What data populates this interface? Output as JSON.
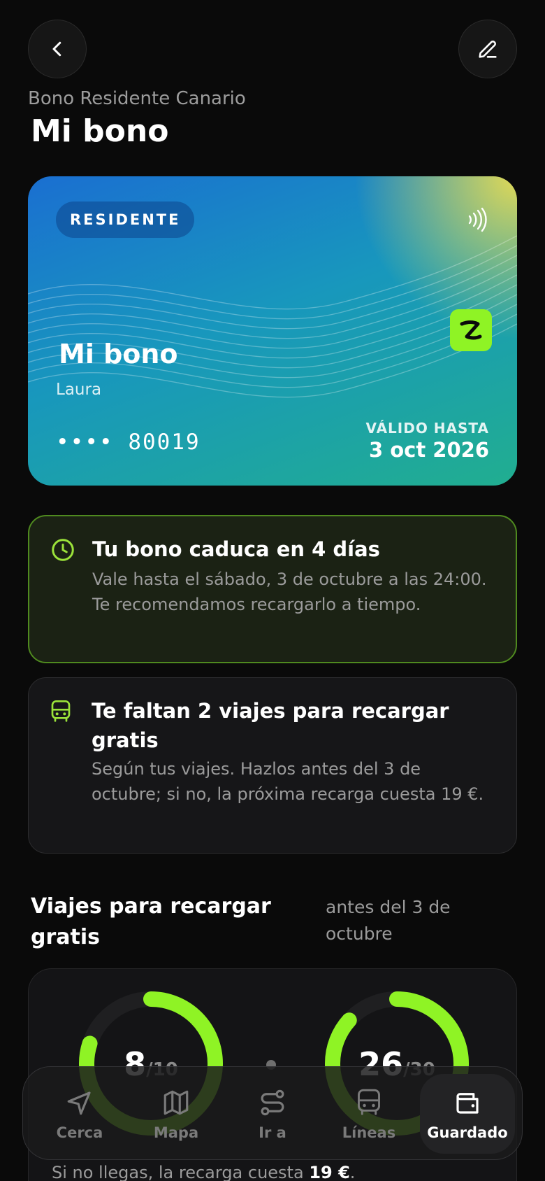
{
  "header": {
    "subtitle": "Bono Residente Canario",
    "title": "Mi bono",
    "back_icon": "chevron-left-icon",
    "edit_icon": "pencil-icon"
  },
  "card": {
    "badge": "RESIDENTE",
    "name": "Mi bono",
    "owner": "Laura",
    "number": "•••• 80019",
    "valid_label": "VÁLIDO HASTA",
    "valid_date": "3 oct 2026",
    "logo_icon": "guaguas-logo-icon",
    "nfc_icon": "contactless-icon",
    "colors": {
      "start": "#1a6fd1",
      "end": "#21ae90",
      "glow": "#ecdd50",
      "logo_bg": "#8ff325"
    }
  },
  "alerts": {
    "expiry": {
      "icon": "clock-icon",
      "title": "Tu bono caduca en 4 días",
      "body": "Vale hasta el sábado, 3 de octubre a las 24:00. Te recomendamos recargarlo a tiempo."
    },
    "trips": {
      "icon": "bus-icon",
      "title": "Te faltan 2 viajes para recargar gratis",
      "body": "Según tus viajes. Hazlos antes del 3 de octubre; si no, la próxima recarga cuesta 19 €."
    }
  },
  "progress": {
    "title": "Viajes para recargar gratis",
    "note": "antes del 3 de octubre",
    "rings": [
      {
        "value": "8",
        "total": "/10",
        "fraction": 0.8
      },
      {
        "value": "26",
        "total": "/30",
        "fraction": 0.8667
      }
    ],
    "footer_prefix": "Si no llegas, la recarga cuesta ",
    "footer_price": "19 €",
    "footer_suffix": ".",
    "accent": "#8ff325"
  },
  "tabbar": {
    "items": [
      {
        "label": "Cerca",
        "icon": "navigation-arrow-icon"
      },
      {
        "label": "Mapa",
        "icon": "map-icon"
      },
      {
        "label": "Ir a",
        "icon": "route-icon"
      },
      {
        "label": "Líneas",
        "icon": "bus-icon"
      },
      {
        "label": "Guardado",
        "icon": "wallet-icon",
        "active": true
      }
    ]
  }
}
